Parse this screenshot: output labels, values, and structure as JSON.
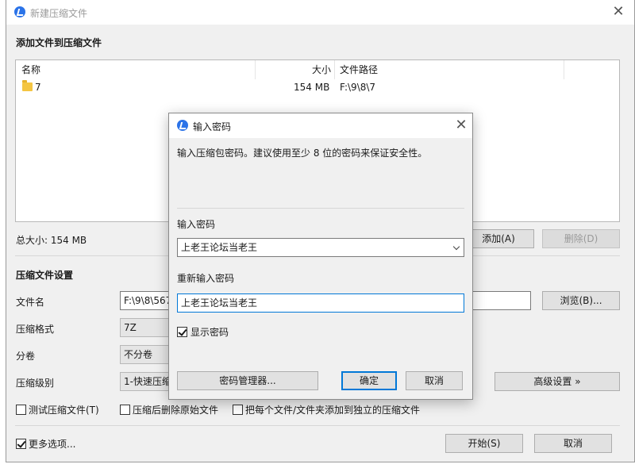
{
  "window": {
    "title": "新建压缩文件",
    "add_files_heading": "添加文件到压缩文件"
  },
  "file_list": {
    "columns": [
      "名称",
      "大小",
      "文件路径"
    ],
    "rows": [
      {
        "name": "7",
        "size": "154 MB",
        "path": "F:\\9\\8\\7"
      }
    ]
  },
  "total_size": "总大小: 154 MB",
  "buttons": {
    "add": "添加(A)",
    "delete": "删除(D)",
    "browse": "浏览(B)...",
    "advanced": "高级设置 »",
    "start": "开始(S)",
    "cancel": "取消"
  },
  "settings": {
    "heading": "压缩文件设置",
    "filename_label": "文件名",
    "filename_value": "F:\\9\\8\\567",
    "format_label": "压缩格式",
    "format_value": "7Z",
    "split_label": "分卷",
    "split_value": "不分卷",
    "level_label": "压缩级别",
    "level_value": "1-快速压缩"
  },
  "options": {
    "test_archive": "测试压缩文件(T)",
    "delete_after": "压缩后删除原始文件",
    "each_separate": "把每个文件/文件夹添加到独立的压缩文件",
    "more_options": "更多选项..."
  },
  "password_dialog": {
    "title": "输入密码",
    "hint": "输入压缩包密码。建议使用至少 8 位的密码来保证安全性。",
    "password_label": "输入密码",
    "password_value": "上老王论坛当老王",
    "reenter_label": "重新输入密码",
    "reenter_value": "上老王论坛当老王",
    "show_password": "显示密码",
    "show_password_checked": true,
    "manager_button": "密码管理器...",
    "ok_button": "确定",
    "cancel_button": "取消"
  },
  "colors": {
    "accent": "#0078d7",
    "logo": "#2b73e8",
    "folder": "#f4c542"
  }
}
